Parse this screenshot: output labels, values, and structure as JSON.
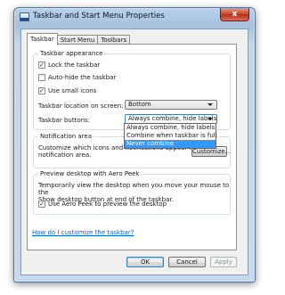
{
  "window": {
    "title": "Taskbar and Start Menu Properties",
    "close_label": "x"
  },
  "tabs": [
    {
      "label": "Taskbar"
    },
    {
      "label": "Start Menu"
    },
    {
      "label": "Toolbars"
    }
  ],
  "taskbar_appearance": {
    "legend": "Taskbar appearance",
    "lock": {
      "label": "Lock the taskbar",
      "checked": true
    },
    "autohide": {
      "label": "Auto-hide the taskbar",
      "checked": false
    },
    "small_icons": {
      "label": "Use small icons",
      "checked": true
    },
    "location_label": "Taskbar location on screen:",
    "location_value": "Bottom",
    "buttons_label": "Taskbar buttons:",
    "buttons_value": "Always combine, hide labels",
    "buttons_options": [
      "Always combine, hide labels",
      "Combine when taskbar is full",
      "Never combine"
    ],
    "buttons_highlighted": "Never combine"
  },
  "notification_area": {
    "legend": "Notification area",
    "description_line1": "Customize which icons and notifications appear in the",
    "description_line2": "notification area.",
    "customize_label": "Customize..."
  },
  "aero_peek": {
    "legend": "Preview desktop with Aero Peek",
    "description_line1": "Temporarily view the desktop when you move your mouse to the",
    "description_line2": "Show desktop button at end of the taskbar.",
    "checkbox": {
      "label": "Use Aero Peek to preview the desktop",
      "checked": true
    }
  },
  "help_link": "How do I customize the taskbar?",
  "buttons": {
    "ok": "OK",
    "cancel": "Cancel",
    "apply": "Apply"
  }
}
